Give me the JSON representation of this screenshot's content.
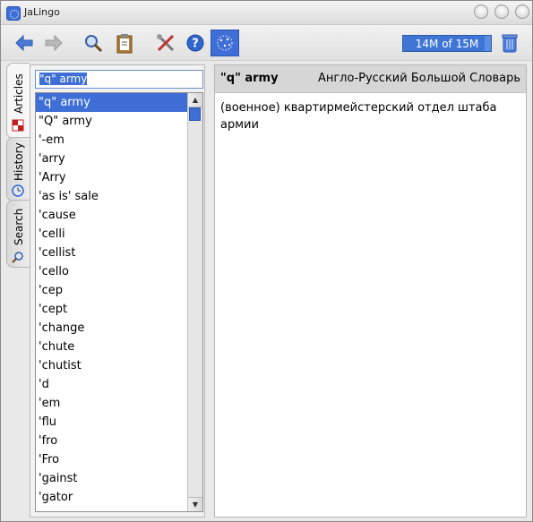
{
  "window": {
    "title": "JaLingo"
  },
  "toolbar": {
    "buttons": [
      "back-icon",
      "forward-icon",
      "search-icon",
      "clipboard-icon",
      "tools-icon",
      "help-icon",
      "stars-icon",
      "trash-icon"
    ],
    "memory_text": "14M of 15M",
    "memory_fraction": 0.93
  },
  "tabs": [
    "Articles",
    "History",
    "Search"
  ],
  "search": {
    "value": "\"q\" army"
  },
  "list": {
    "selected_index": 0,
    "items": [
      "\"q\" army",
      "\"Q\" army",
      "'-em",
      "'arry",
      "'Arry",
      "'as is' sale",
      "'cause",
      "'celli",
      "'cellist",
      "'cello",
      "'cep",
      "'cept",
      "'change",
      "'chute",
      "'chutist",
      "'d",
      "'em",
      "'flu",
      "'fro",
      "'Fro",
      "'gainst",
      "'gator"
    ]
  },
  "article": {
    "headword": "\"q\" army",
    "dictionary": "Англо-Русский Большой Словарь",
    "text": "(военное) квартирмейстерский отдел штаба армии"
  },
  "colors": {
    "accent": "#3f6fd6"
  }
}
